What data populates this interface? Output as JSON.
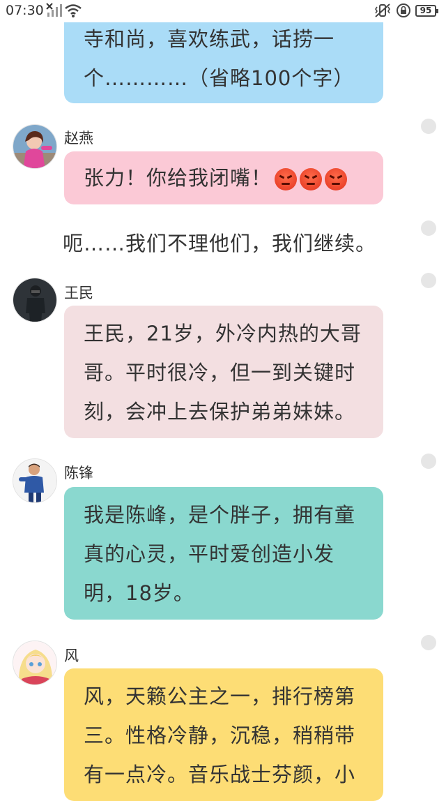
{
  "status_bar": {
    "time": "07:30",
    "battery": "95"
  },
  "messages": [
    {
      "type": "bubble",
      "lines": [
        "寺和尚，喜欢练武，话捞一",
        "个…………（省略100个字）"
      ]
    },
    {
      "type": "bubble",
      "sender": "赵燕",
      "text": "张力！你给我闭嘴！",
      "emoji_count": 3
    },
    {
      "type": "plain",
      "text": "呃……我们不理他们，我们继续。"
    },
    {
      "type": "bubble",
      "sender": "王民",
      "lines": [
        "王民，21岁，外冷内热的大哥",
        "哥。平时很冷，但一到关键时",
        "刻，会冲上去保护弟弟妹妹。"
      ]
    },
    {
      "type": "bubble",
      "sender": "陈锋",
      "lines": [
        "我是陈峰，是个胖子，拥有童",
        "真的心灵，平时爱创造小发",
        "明，18岁。"
      ]
    },
    {
      "type": "bubble",
      "sender": "风",
      "lines": [
        "风，天籁公主之一，排行榜第",
        "三。性格冷静，沉稳，稍稍带",
        "有一点冷。音乐战士芬颜，小"
      ]
    }
  ],
  "colors": {
    "blue_bubble": "#aadcf7",
    "pink_bubble": "#fbc9d6",
    "rose_bubble": "#f3dfe1",
    "teal_bubble": "#8ad8cf",
    "yellow_bubble": "#fddd75"
  },
  "icons": {
    "signal": "signal-off-icon",
    "wifi": "wifi-icon",
    "vibrate": "vibrate-icon",
    "rotation_lock": "rotation-lock-icon"
  }
}
